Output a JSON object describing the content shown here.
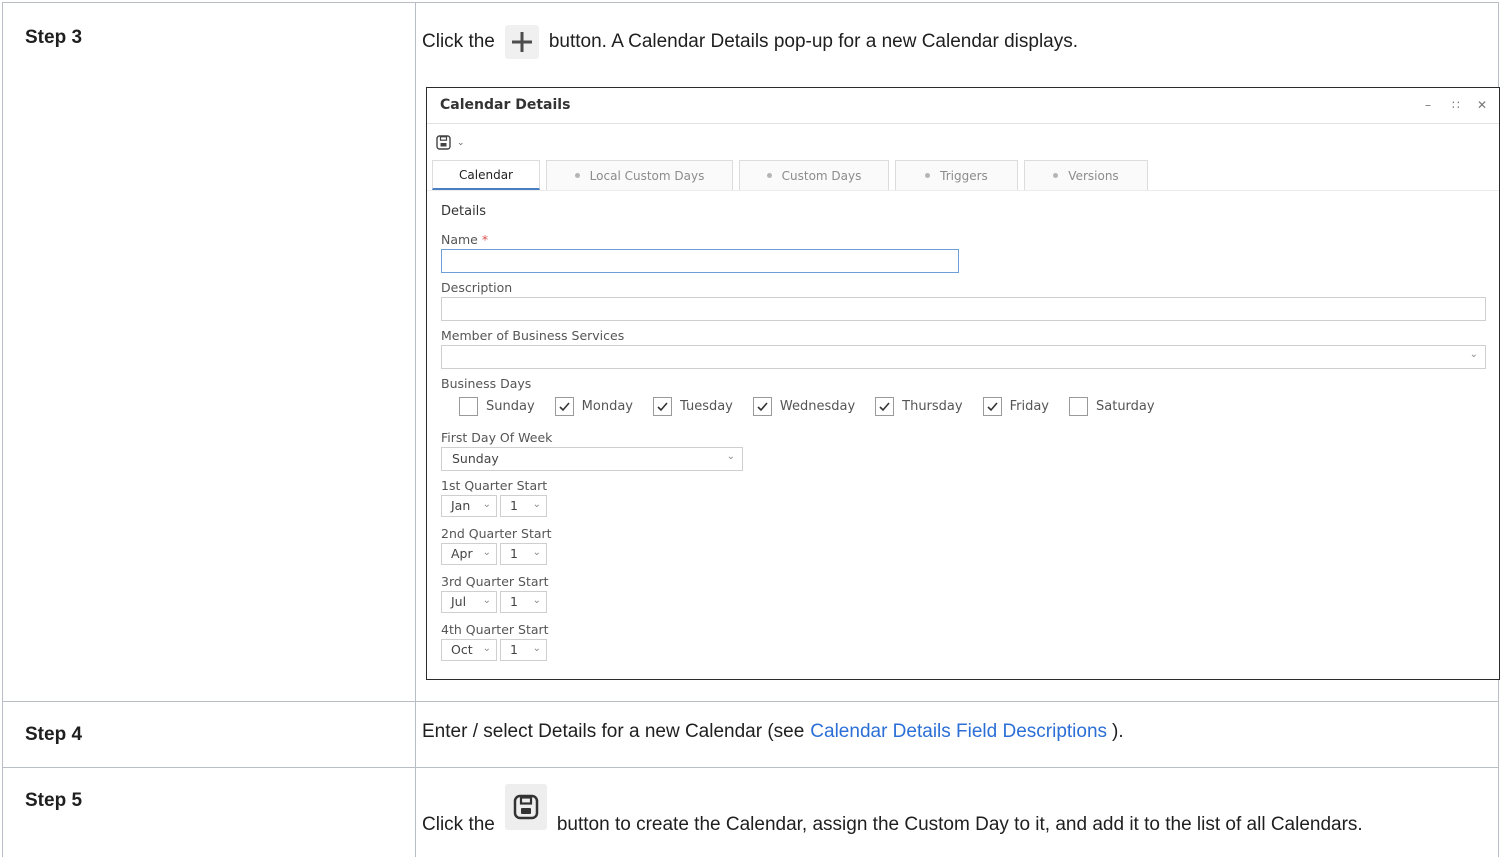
{
  "steps": [
    {
      "label": "Step 3",
      "text_before": "Click the",
      "text_after": "button. A Calendar Details pop-up for a new Calendar displays.",
      "button_icon": "plus-icon"
    },
    {
      "label": "Step 4",
      "text_before": "Enter / select Details for a new Calendar (see",
      "link_text": "Calendar Details Field Descriptions",
      "text_after": ")."
    },
    {
      "label": "Step 5",
      "text_before": "Click the",
      "text_after": "button to create the Calendar, assign the Custom Day to it, and add it to the list of all Calendars.",
      "button_icon": "save-icon"
    }
  ],
  "dialog": {
    "title": "Calendar Details",
    "tabs": [
      {
        "label": "Calendar",
        "active": true
      },
      {
        "label": "Local Custom Days",
        "active": false
      },
      {
        "label": "Custom Days",
        "active": false
      },
      {
        "label": "Triggers",
        "active": false
      },
      {
        "label": "Versions",
        "active": false
      }
    ],
    "section_title": "Details",
    "name_label": "Name",
    "name_required_mark": "*",
    "name_value": "",
    "description_label": "Description",
    "description_value": "",
    "member_label": "Member of Business Services",
    "member_value": "",
    "business_days_label": "Business Days",
    "business_days": [
      {
        "label": "Sunday",
        "checked": false
      },
      {
        "label": "Monday",
        "checked": true
      },
      {
        "label": "Tuesday",
        "checked": true
      },
      {
        "label": "Wednesday",
        "checked": true
      },
      {
        "label": "Thursday",
        "checked": true
      },
      {
        "label": "Friday",
        "checked": true
      },
      {
        "label": "Saturday",
        "checked": false
      }
    ],
    "first_day_label": "First Day Of Week",
    "first_day_value": "Sunday",
    "quarters": [
      {
        "label": "1st Quarter Start",
        "month": "Jan",
        "day": "1"
      },
      {
        "label": "2nd Quarter Start",
        "month": "Apr",
        "day": "1"
      },
      {
        "label": "3rd Quarter Start",
        "month": "Jul",
        "day": "1"
      },
      {
        "label": "4th Quarter Start",
        "month": "Oct",
        "day": "1"
      }
    ]
  },
  "colors": {
    "link": "#2b6fd6",
    "active_tab_underline": "#4a7ec2",
    "required": "#d9534f",
    "table_border": "#b9bec6"
  }
}
